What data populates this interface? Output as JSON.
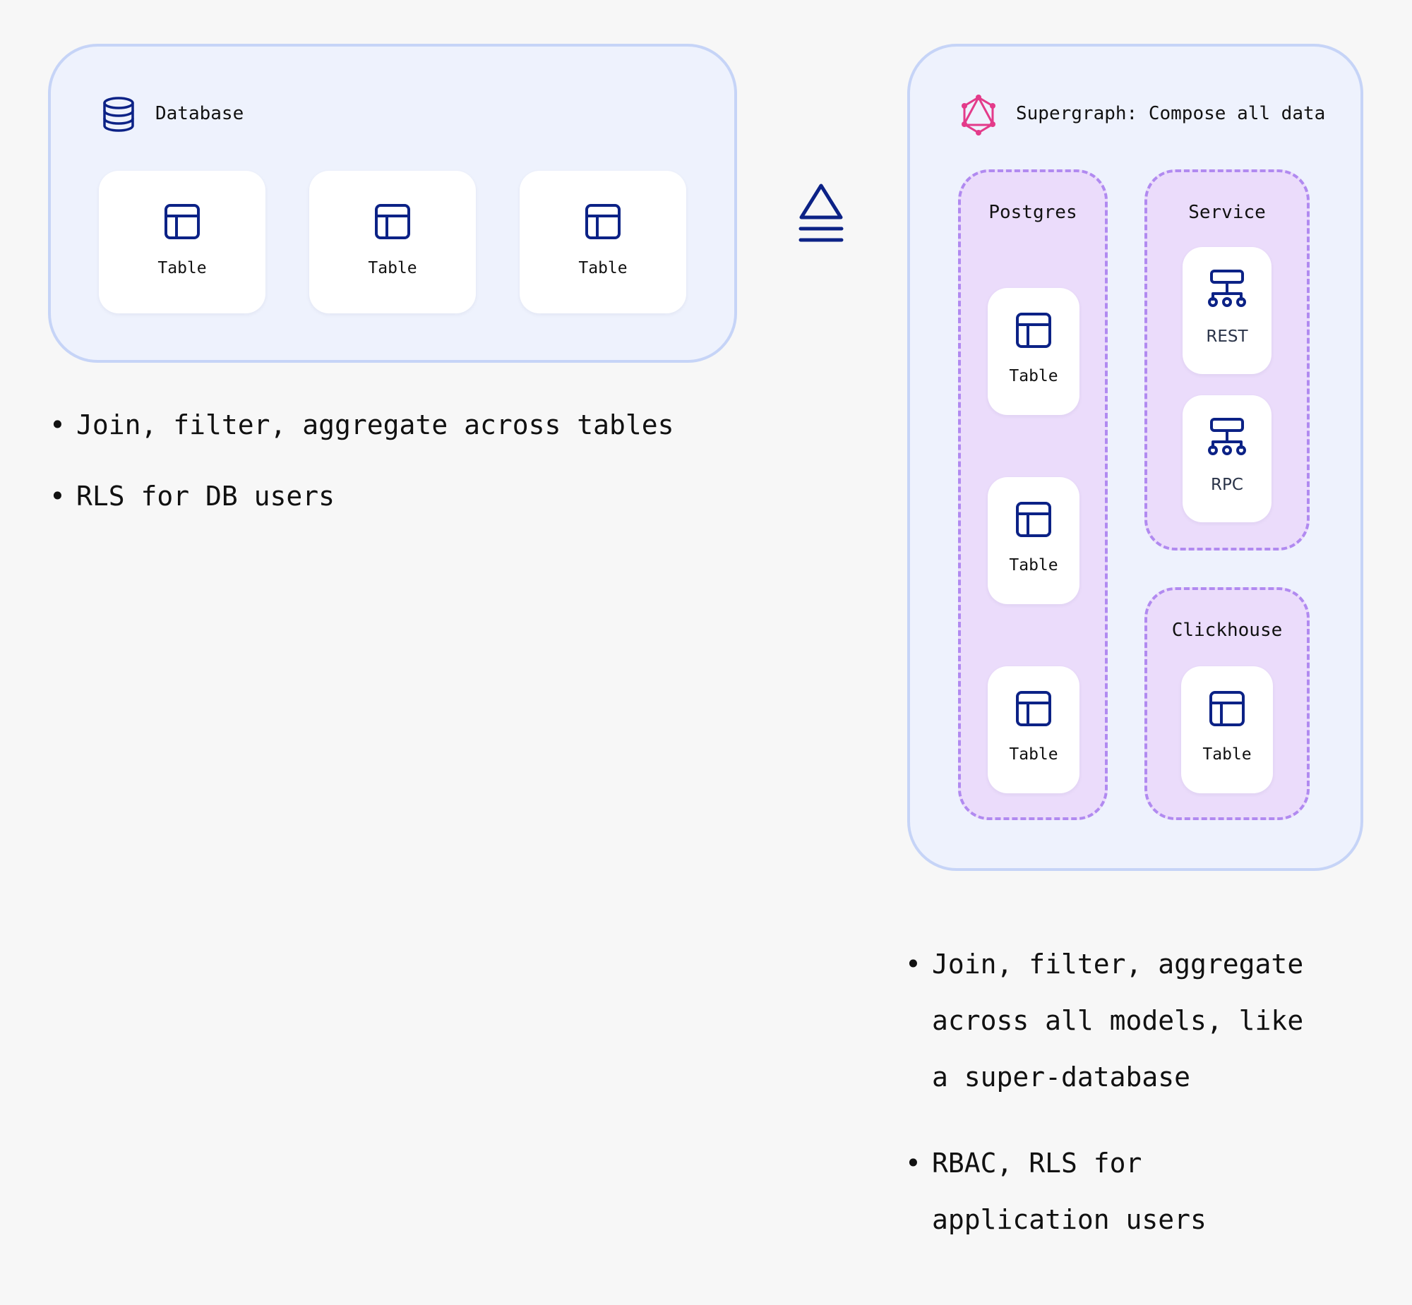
{
  "database": {
    "title": "Database",
    "tables": [
      "Table",
      "Table",
      "Table"
    ]
  },
  "left_bullets": [
    "Join, filter, aggregate across tables",
    "RLS for DB users"
  ],
  "supergraph": {
    "title": "Supergraph: Compose all data",
    "postgres": {
      "title": "Postgres",
      "tables": [
        "Table",
        "Table",
        "Table"
      ]
    },
    "service": {
      "title": "Service",
      "items": [
        "REST",
        "RPC"
      ]
    },
    "clickhouse": {
      "title": "Clickhouse",
      "tables": [
        "Table"
      ]
    }
  },
  "right_bullets": [
    "Join, filter, aggregate across all models, like a super-database",
    "RBAC, RLS for application users"
  ],
  "icons": {
    "database": "database-icon",
    "graphql": "graphql-icon",
    "table": "table-icon",
    "api": "api-icon",
    "arrow": "superset-arrow-icon"
  },
  "colors": {
    "icon_stroke": "#0c2286",
    "graphql_pink": "#e33b8a",
    "panel_fill": "#eef2fd",
    "panel_border": "#c6d4f7",
    "group_fill": "#ebdcfb",
    "group_border": "#b18af0"
  }
}
